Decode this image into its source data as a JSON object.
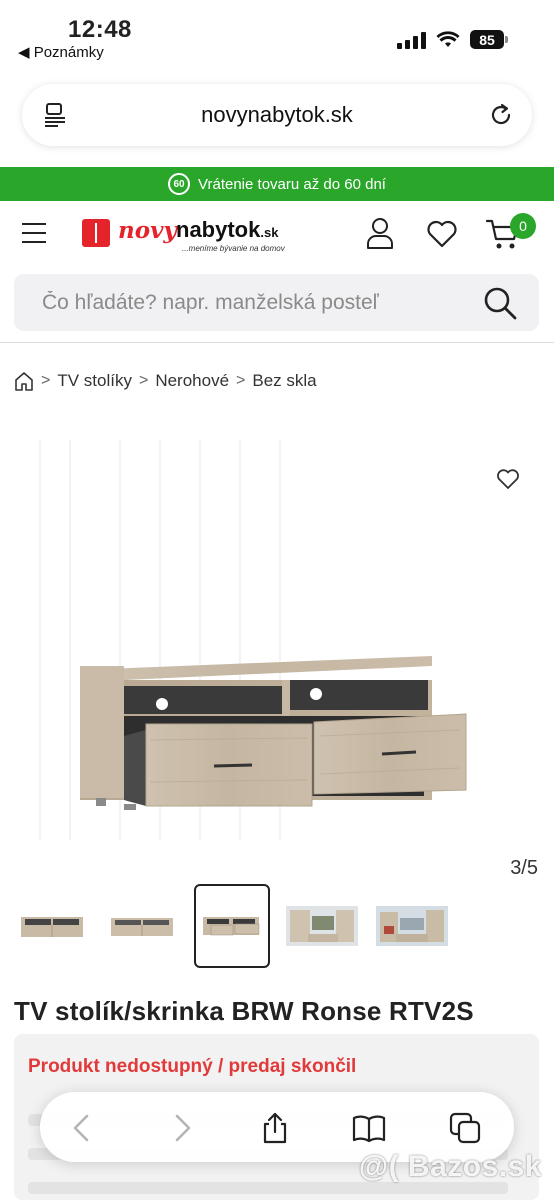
{
  "status_bar": {
    "time": "12:48",
    "back_label": "◀ Poznámky",
    "battery": "85"
  },
  "browser": {
    "url": "novynabytok.sk",
    "toolbar": [
      "back-icon",
      "forward-icon",
      "share-icon",
      "bookmarks-icon",
      "tabs-icon"
    ]
  },
  "promo": {
    "badge": "60",
    "text": "Vrátenie tovaru až do 60 dní",
    "color": "#2aa72a"
  },
  "header": {
    "logo_novy": "novy",
    "logo_nabytok": "nabytok",
    "logo_sk": ".sk",
    "logo_tagline": "...meníme bývanie na domov",
    "cart_count": "0",
    "brand_color": "#e5232b"
  },
  "search": {
    "placeholder": "Čo hľadáte? napr. manželská posteľ"
  },
  "breadcrumb": {
    "items": [
      "TV stolíky",
      "Nerohové",
      "Bez skla"
    ],
    "separator": ">"
  },
  "gallery": {
    "counter": "3/5",
    "active_index": 2
  },
  "product": {
    "title": "TV stolík/skrinka BRW Ronse RTV2S",
    "availability": "Produkt nedostupný / predaj skončil",
    "availability_color": "#e23a3a"
  },
  "watermark": "@( Bazos.sk"
}
